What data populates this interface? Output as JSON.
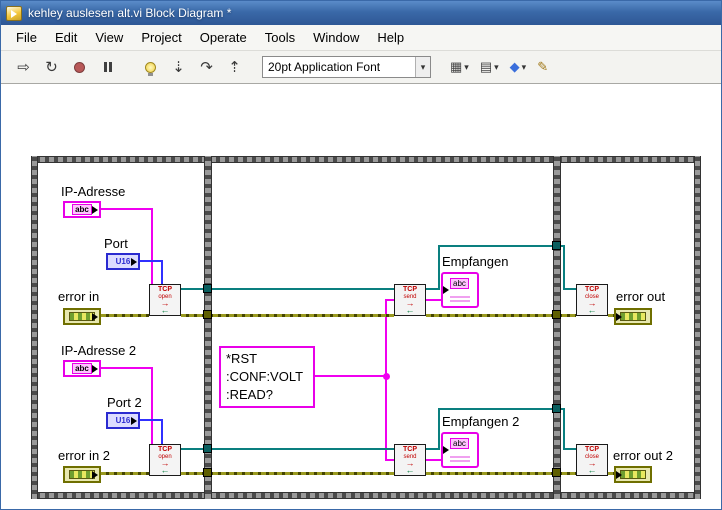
{
  "window": {
    "title": "kehley auslesen alt.vi Block Diagram *"
  },
  "menu": {
    "items": [
      "File",
      "Edit",
      "View",
      "Project",
      "Operate",
      "Tools",
      "Window",
      "Help"
    ]
  },
  "toolbar": {
    "font_selector": "20pt Application Font",
    "glyphs": {
      "run": "⇨",
      "run_continuous": "↻",
      "step_into": "⇣",
      "step_over": "↷",
      "step_out": "⇡",
      "dropdown": "▾",
      "align": "▦",
      "distribute": "▤",
      "reorder": "◆",
      "cleanup": "✎"
    }
  },
  "diagram": {
    "labels": {
      "ip": "IP-Adresse",
      "port": "Port",
      "error_in": "error in",
      "ip2": "IP-Adresse 2",
      "port2": "Port 2",
      "error_in2": "error in  2",
      "empfangen": "Empfangen",
      "empfangen2": "Empfangen 2",
      "error_out": "error out",
      "error_out2": "error out 2"
    },
    "string_constant": "*RST\n:CONF:VOLT\n:READ?",
    "icons": {
      "abc": "abc",
      "u16": "U16",
      "tcp": "TCP",
      "open": "open",
      "send": "send",
      "close": "close",
      "arrow_right": "→",
      "arrow_left": "←"
    },
    "colors": {
      "string_wire": "#f000f0",
      "numeric_wire": "#3030ff",
      "connection_wire": "#0a7f7f",
      "error_wire": "#8a8a10"
    }
  }
}
